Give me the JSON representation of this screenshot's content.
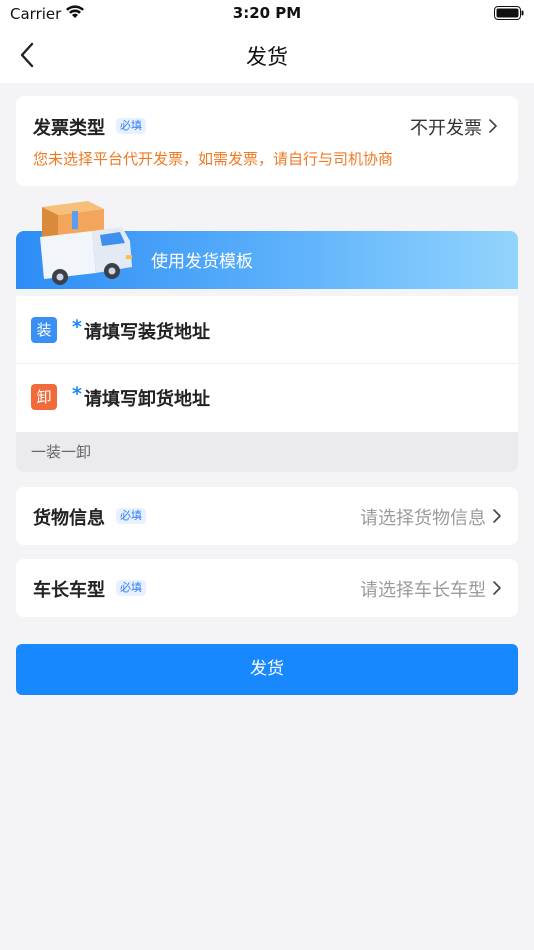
{
  "status_bar": {
    "carrier": "Carrier",
    "time": "3:20 PM",
    "icons": [
      "wifi-icon",
      "battery-icon"
    ]
  },
  "nav": {
    "title": "发货",
    "back_icon": "chevron-left-icon"
  },
  "invoice": {
    "label": "发票类型",
    "required_badge": "必填",
    "value": "不开发票",
    "note": "您未选择平台代开发票，如需发票，请自行与司机协商"
  },
  "template_banner": {
    "label": "使用发货模板",
    "illustration": "truck-with-box-illustration"
  },
  "address": {
    "loading": {
      "tag": "装",
      "required_mark": "*",
      "placeholder": "请填写装货地址",
      "tag_color": "#3b8ff3"
    },
    "unloading": {
      "tag": "卸",
      "required_mark": "*",
      "placeholder": "请填写卸货地址",
      "tag_color": "#f06a3a"
    },
    "route_summary": "一装一卸"
  },
  "goods": {
    "label": "货物信息",
    "required_badge": "必填",
    "placeholder": "请选择货物信息"
  },
  "vehicle": {
    "label": "车长车型",
    "required_badge": "必填",
    "placeholder": "请选择车长车型"
  },
  "submit": {
    "label": "发货",
    "color": "#1888ff"
  }
}
